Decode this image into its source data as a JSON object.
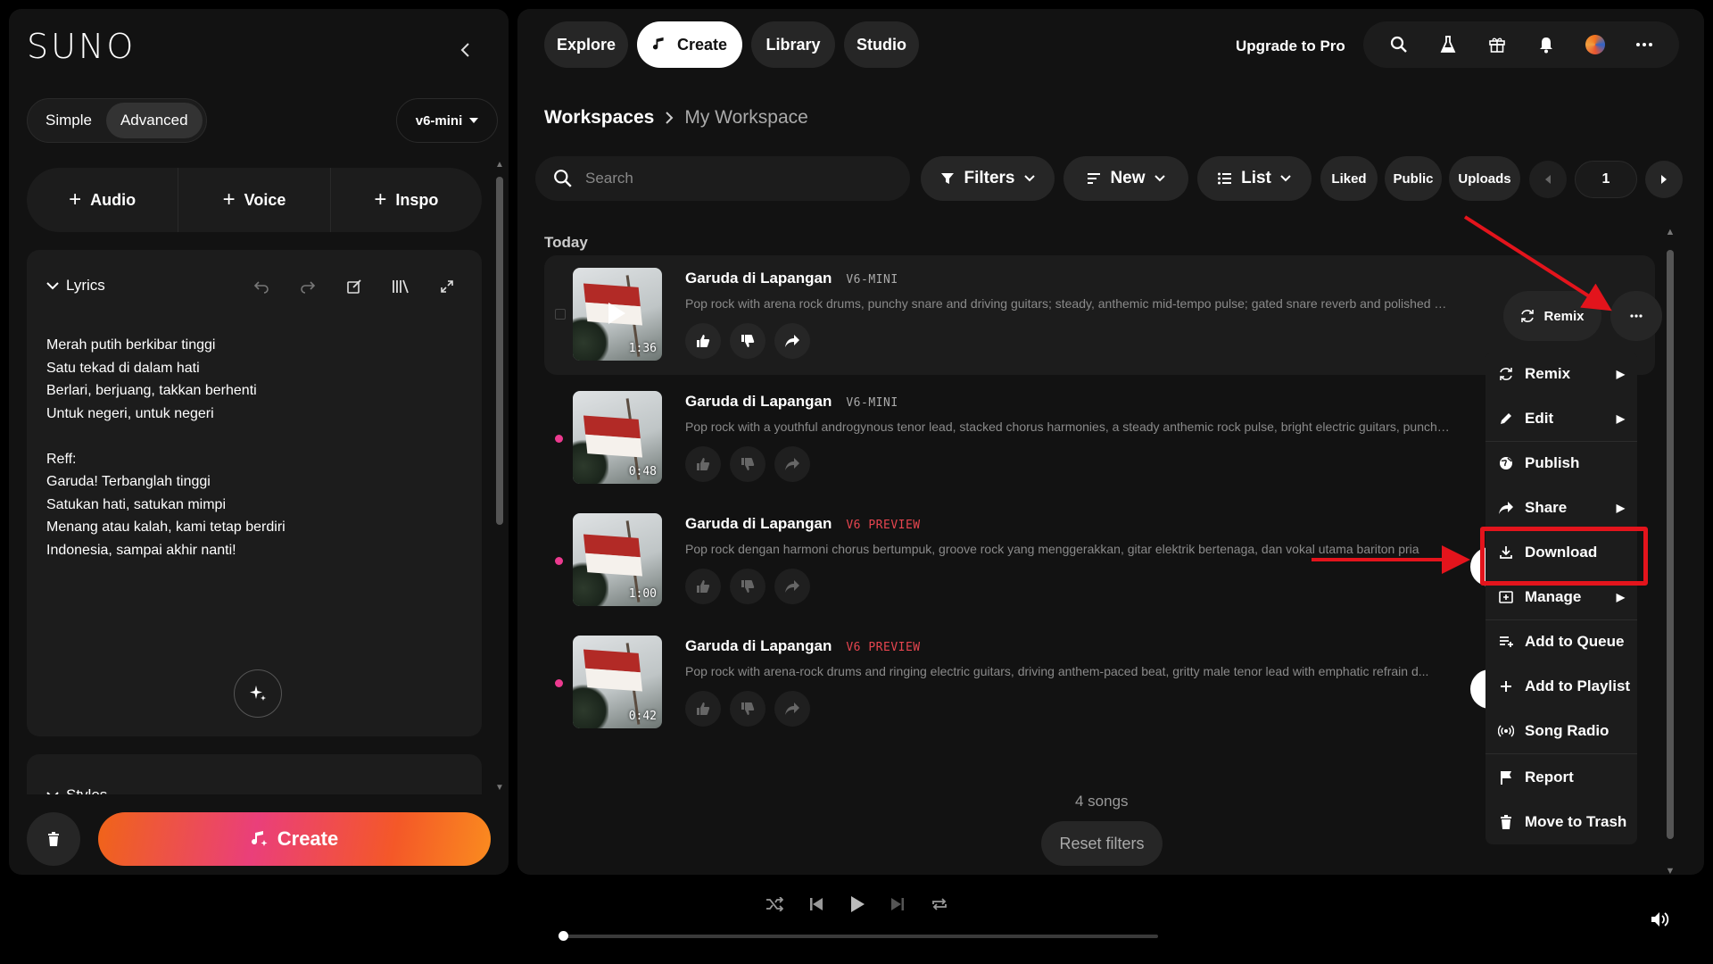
{
  "sidebar": {
    "logo": "SUNO",
    "mode_simple": "Simple",
    "mode_advanced": "Advanced",
    "model": "v6-mini",
    "add_audio": "Audio",
    "add_voice": "Voice",
    "add_inspo": "Inspo",
    "lyrics_label": "Lyrics",
    "lyrics_text": "Merah putih berkibar tinggi\nSatu tekad di dalam hati\nBerlari, berjuang, takkan berhenti\nUntuk negeri, untuk negeri\n\nReff:\nGaruda! Terbanglah tinggi\nSatukan hati, satukan mimpi\nMenang atau kalah, kami tetap berdiri\nIndonesia, sampai akhir nanti!",
    "styles_label": "Styles",
    "create_label": "Create"
  },
  "topnav": {
    "explore": "Explore",
    "create": "Create",
    "library": "Library",
    "studio": "Studio",
    "upgrade": "Upgrade to Pro"
  },
  "breadcrumb": {
    "root": "Workspaces",
    "current": "My Workspace"
  },
  "toolbar": {
    "search_placeholder": "Search",
    "filters": "Filters",
    "sort": "New",
    "view": "List",
    "liked": "Liked",
    "public": "Public",
    "uploads": "Uploads",
    "page": "1"
  },
  "section_label": "Today",
  "songs": [
    {
      "title": "Garuda di Lapangan",
      "tag": "V6-MINI",
      "duration": "1:36",
      "desc": "Pop rock with arena rock drums, punchy snare and driving guitars; steady, anthemic mid-tempo pulse; gated snare reverb and polished production"
    },
    {
      "title": "Garuda di Lapangan",
      "tag": "V6-MINI",
      "duration": "0:48",
      "desc": "Pop rock with a youthful androgynous tenor lead, stacked chorus harmonies, a steady anthemic rock pulse, bright electric guitars, punchy drums"
    },
    {
      "title": "Garuda di Lapangan",
      "tag": "V6 PREVIEW",
      "duration": "1:00",
      "desc": "Pop rock dengan harmoni chorus bertumpuk, groove rock yang menggerakkan, gitar elektrik bertenaga, dan vokal utama bariton pria"
    },
    {
      "title": "Garuda di Lapangan",
      "tag": "V6 PREVIEW",
      "duration": "0:42",
      "desc": "Pop rock with arena-rock drums and ringing electric guitars, driving anthem-paced beat, gritty male tenor lead with emphatic refrain d..."
    }
  ],
  "remix_label": "Remix",
  "songs_count": "4 songs",
  "reset_filters": "Reset filters",
  "menu": {
    "remix": "Remix",
    "edit": "Edit",
    "publish": "Publish",
    "share": "Share",
    "download": "Download",
    "manage": "Manage",
    "add_queue": "Add to Queue",
    "add_playlist": "Add to Playlist",
    "song_radio": "Song Radio",
    "report": "Report",
    "trash": "Move to Trash"
  },
  "colors": {
    "accent_gradient_start": "#f06418",
    "accent_gradient_mid": "#ea3f7a",
    "annotation_red": "#e3141c",
    "new_dot": "#ec3a8f"
  }
}
